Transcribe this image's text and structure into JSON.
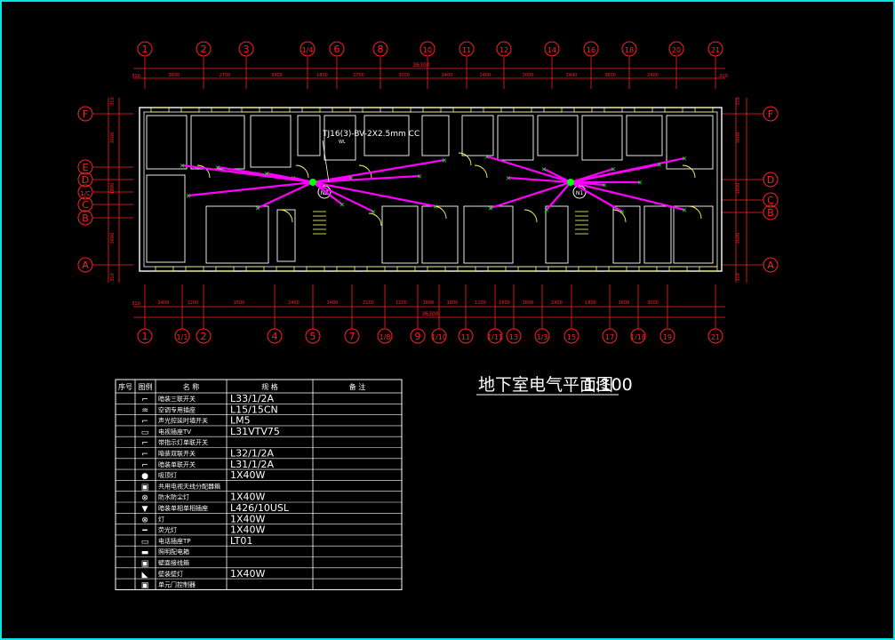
{
  "drawing": {
    "title": "地下室电气平面图",
    "scale": "1:100",
    "cable_note": "TJ16(3)-BV-2X2.5mm CC",
    "cable_sub": "WL",
    "panel_labels": [
      "NZ",
      "N1"
    ]
  },
  "axes": {
    "top_bubbles": [
      "1",
      "2",
      "3",
      "1/4",
      "6",
      "8",
      "10",
      "11",
      "12",
      "14",
      "16",
      "18",
      "20",
      "21"
    ],
    "top_dims": [
      "3600",
      "2700",
      "3900",
      "1800",
      "2700",
      "3000",
      "2400",
      "2400",
      "3000",
      "2400",
      "3600",
      "2400"
    ],
    "top_total": "36300",
    "bottom_bubbles": [
      "1",
      "1/1",
      "2",
      "4",
      "5",
      "7",
      "1/8",
      "9",
      "1/10",
      "11",
      "1/11",
      "13",
      "1/3",
      "15",
      "17",
      "1/18",
      "19",
      "21"
    ],
    "bottom_dims": [
      "2400",
      "1200",
      "1500",
      "2400",
      "2400",
      "2100",
      "1200",
      "1800",
      "1800",
      "1200",
      "1800",
      "1800",
      "2400",
      "1800",
      "1800",
      "3000"
    ],
    "bottom_total": "36300",
    "left_bubbles": [
      "F",
      "E",
      "D",
      "1/C",
      "C",
      "B",
      "A"
    ],
    "right_bubbles": [
      "F",
      "D",
      "C",
      "B",
      "A"
    ],
    "side_dims": [
      "310",
      "3600",
      "1800",
      "3600",
      "310"
    ],
    "end_dim": "310"
  },
  "legend": {
    "headers": [
      "序号",
      "图例",
      "名 称",
      "规 格",
      "备 注"
    ],
    "rows": [
      {
        "sym": "sw3",
        "name": "暗装三联开关",
        "spec": "L33/1/2A"
      },
      {
        "sym": "sock",
        "name": "空调专用插座",
        "spec": "L15/15CN"
      },
      {
        "sym": "sw1",
        "name": "声光控延时墙开关",
        "spec": "LM5"
      },
      {
        "sym": "tv",
        "name": "电视插座TV",
        "spec": "L31VTV75"
      },
      {
        "sym": "sw4",
        "name": "带指示灯单联开关",
        "spec": ""
      },
      {
        "sym": "sw2",
        "name": "暗装双联开关",
        "spec": "L32/1/2A"
      },
      {
        "sym": "sw1b",
        "name": "暗装单联开关",
        "spec": "L31/1/2A"
      },
      {
        "sym": "dot",
        "name": "吸顶灯",
        "spec": "1X40W"
      },
      {
        "sym": "box",
        "name": "共用电视天线分配器箱",
        "spec": ""
      },
      {
        "sym": "wp",
        "name": "防水防尘灯",
        "spec": "1X40W"
      },
      {
        "sym": "socket2",
        "name": "暗装单相单相插座",
        "spec": "L426/10USL"
      },
      {
        "sym": "x",
        "name": "灯",
        "spec": "1X40W"
      },
      {
        "sym": "tube",
        "name": "荧光灯",
        "spec": "1X40W"
      },
      {
        "sym": "tel",
        "name": "电话插座TP",
        "spec": "LT01"
      },
      {
        "sym": "panel",
        "name": "照明配电箱",
        "spec": ""
      },
      {
        "sym": "jb",
        "name": "壁面接线箱",
        "spec": ""
      },
      {
        "sym": "wall",
        "name": "壁装壁灯",
        "spec": "1X40W"
      },
      {
        "sym": "door",
        "name": "单元门控制器",
        "spec": ""
      }
    ]
  },
  "colors": {
    "frame": "#00e5e5",
    "wall": "#ffffff",
    "window": "#ffff66",
    "axis": "#ff2020",
    "wire": "#ff00ff",
    "fixture": "#00ff00"
  }
}
